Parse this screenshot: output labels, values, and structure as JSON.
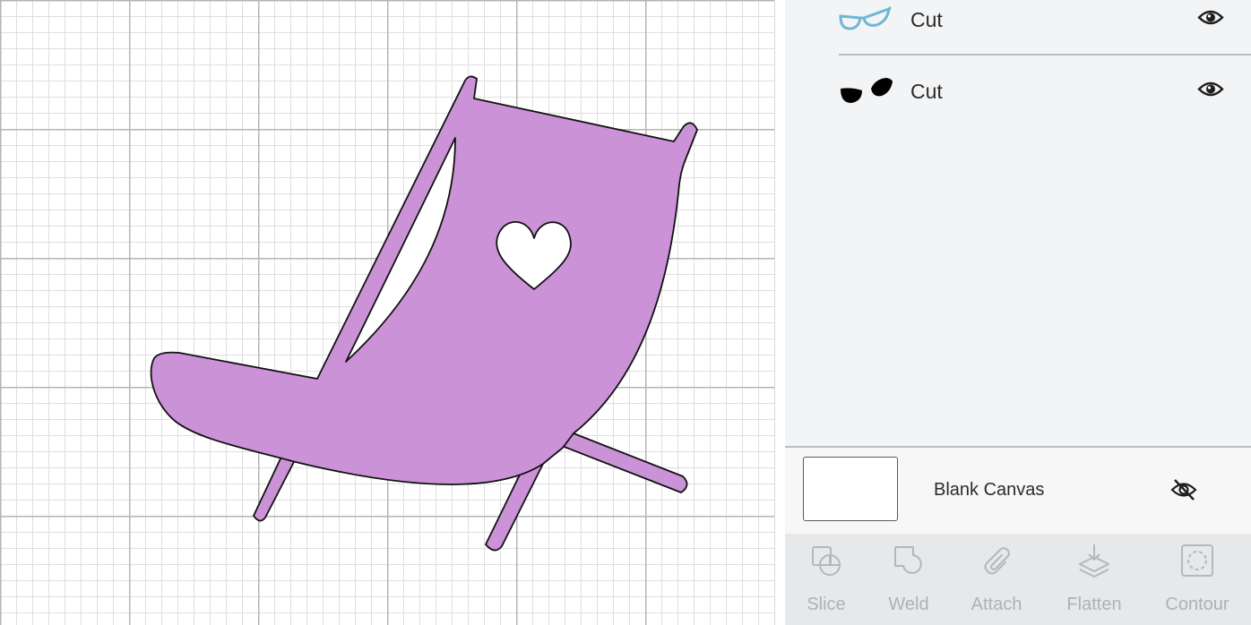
{
  "canvas": {
    "grid_color_major": "#b5b5b5",
    "grid_color_minor": "#dedede",
    "chair_fill": "#cc92d8",
    "chair_stroke": "#111111"
  },
  "layers": {
    "items": [
      {
        "label": "Cut",
        "icon": "glasses-icon",
        "icon_color": "#6fb7d6",
        "visible": true
      },
      {
        "label": "Cut",
        "icon": "lenses-icon",
        "icon_color": "#000000",
        "visible": true
      }
    ],
    "blank_canvas": {
      "label": "Blank Canvas",
      "visible": false
    }
  },
  "toolbar": {
    "slice": "Slice",
    "weld": "Weld",
    "attach": "Attach",
    "flatten": "Flatten",
    "contour": "Contour"
  }
}
